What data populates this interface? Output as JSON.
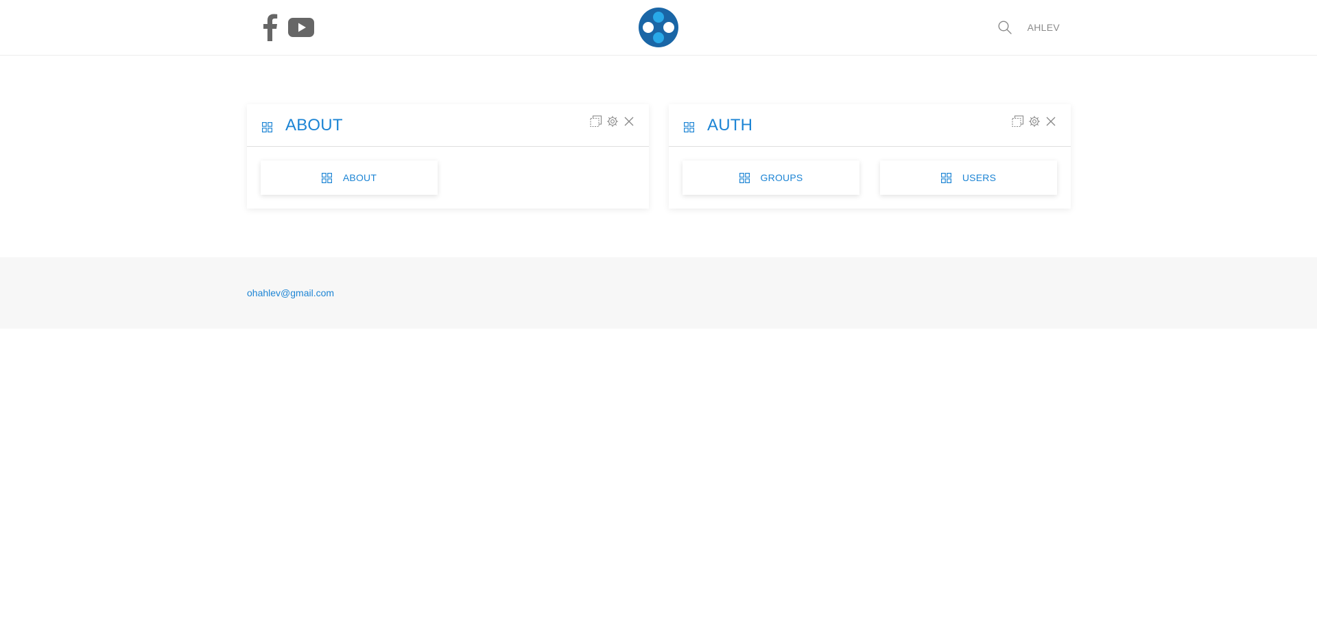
{
  "header": {
    "social": [
      {
        "icon": "facebook-icon"
      },
      {
        "icon": "youtube-icon"
      }
    ],
    "logo": {
      "icon": "four-circles-logo"
    },
    "search": {
      "icon": "search-icon"
    },
    "user_label": "AHLEV"
  },
  "panels": [
    {
      "title": "ABOUT",
      "icon": "grid-icon",
      "tools": [
        "copy-icon",
        "gear-icon",
        "close-icon"
      ],
      "tiles": [
        {
          "label": "ABOUT",
          "icon": "grid-icon"
        }
      ]
    },
    {
      "title": "AUTH",
      "icon": "grid-icon",
      "tools": [
        "copy-icon",
        "gear-icon",
        "close-icon"
      ],
      "tiles": [
        {
          "label": "GROUPS",
          "icon": "grid-icon"
        },
        {
          "label": "USERS",
          "icon": "grid-icon"
        }
      ]
    }
  ],
  "footer": {
    "email": "ohahlev@gmail.com"
  },
  "colors": {
    "accent": "#1c84d4",
    "logo_dark": "#1a66a6",
    "logo_light": "#29a9e8",
    "icon_gray": "#666666",
    "footer_bg": "#f7f7f7"
  }
}
